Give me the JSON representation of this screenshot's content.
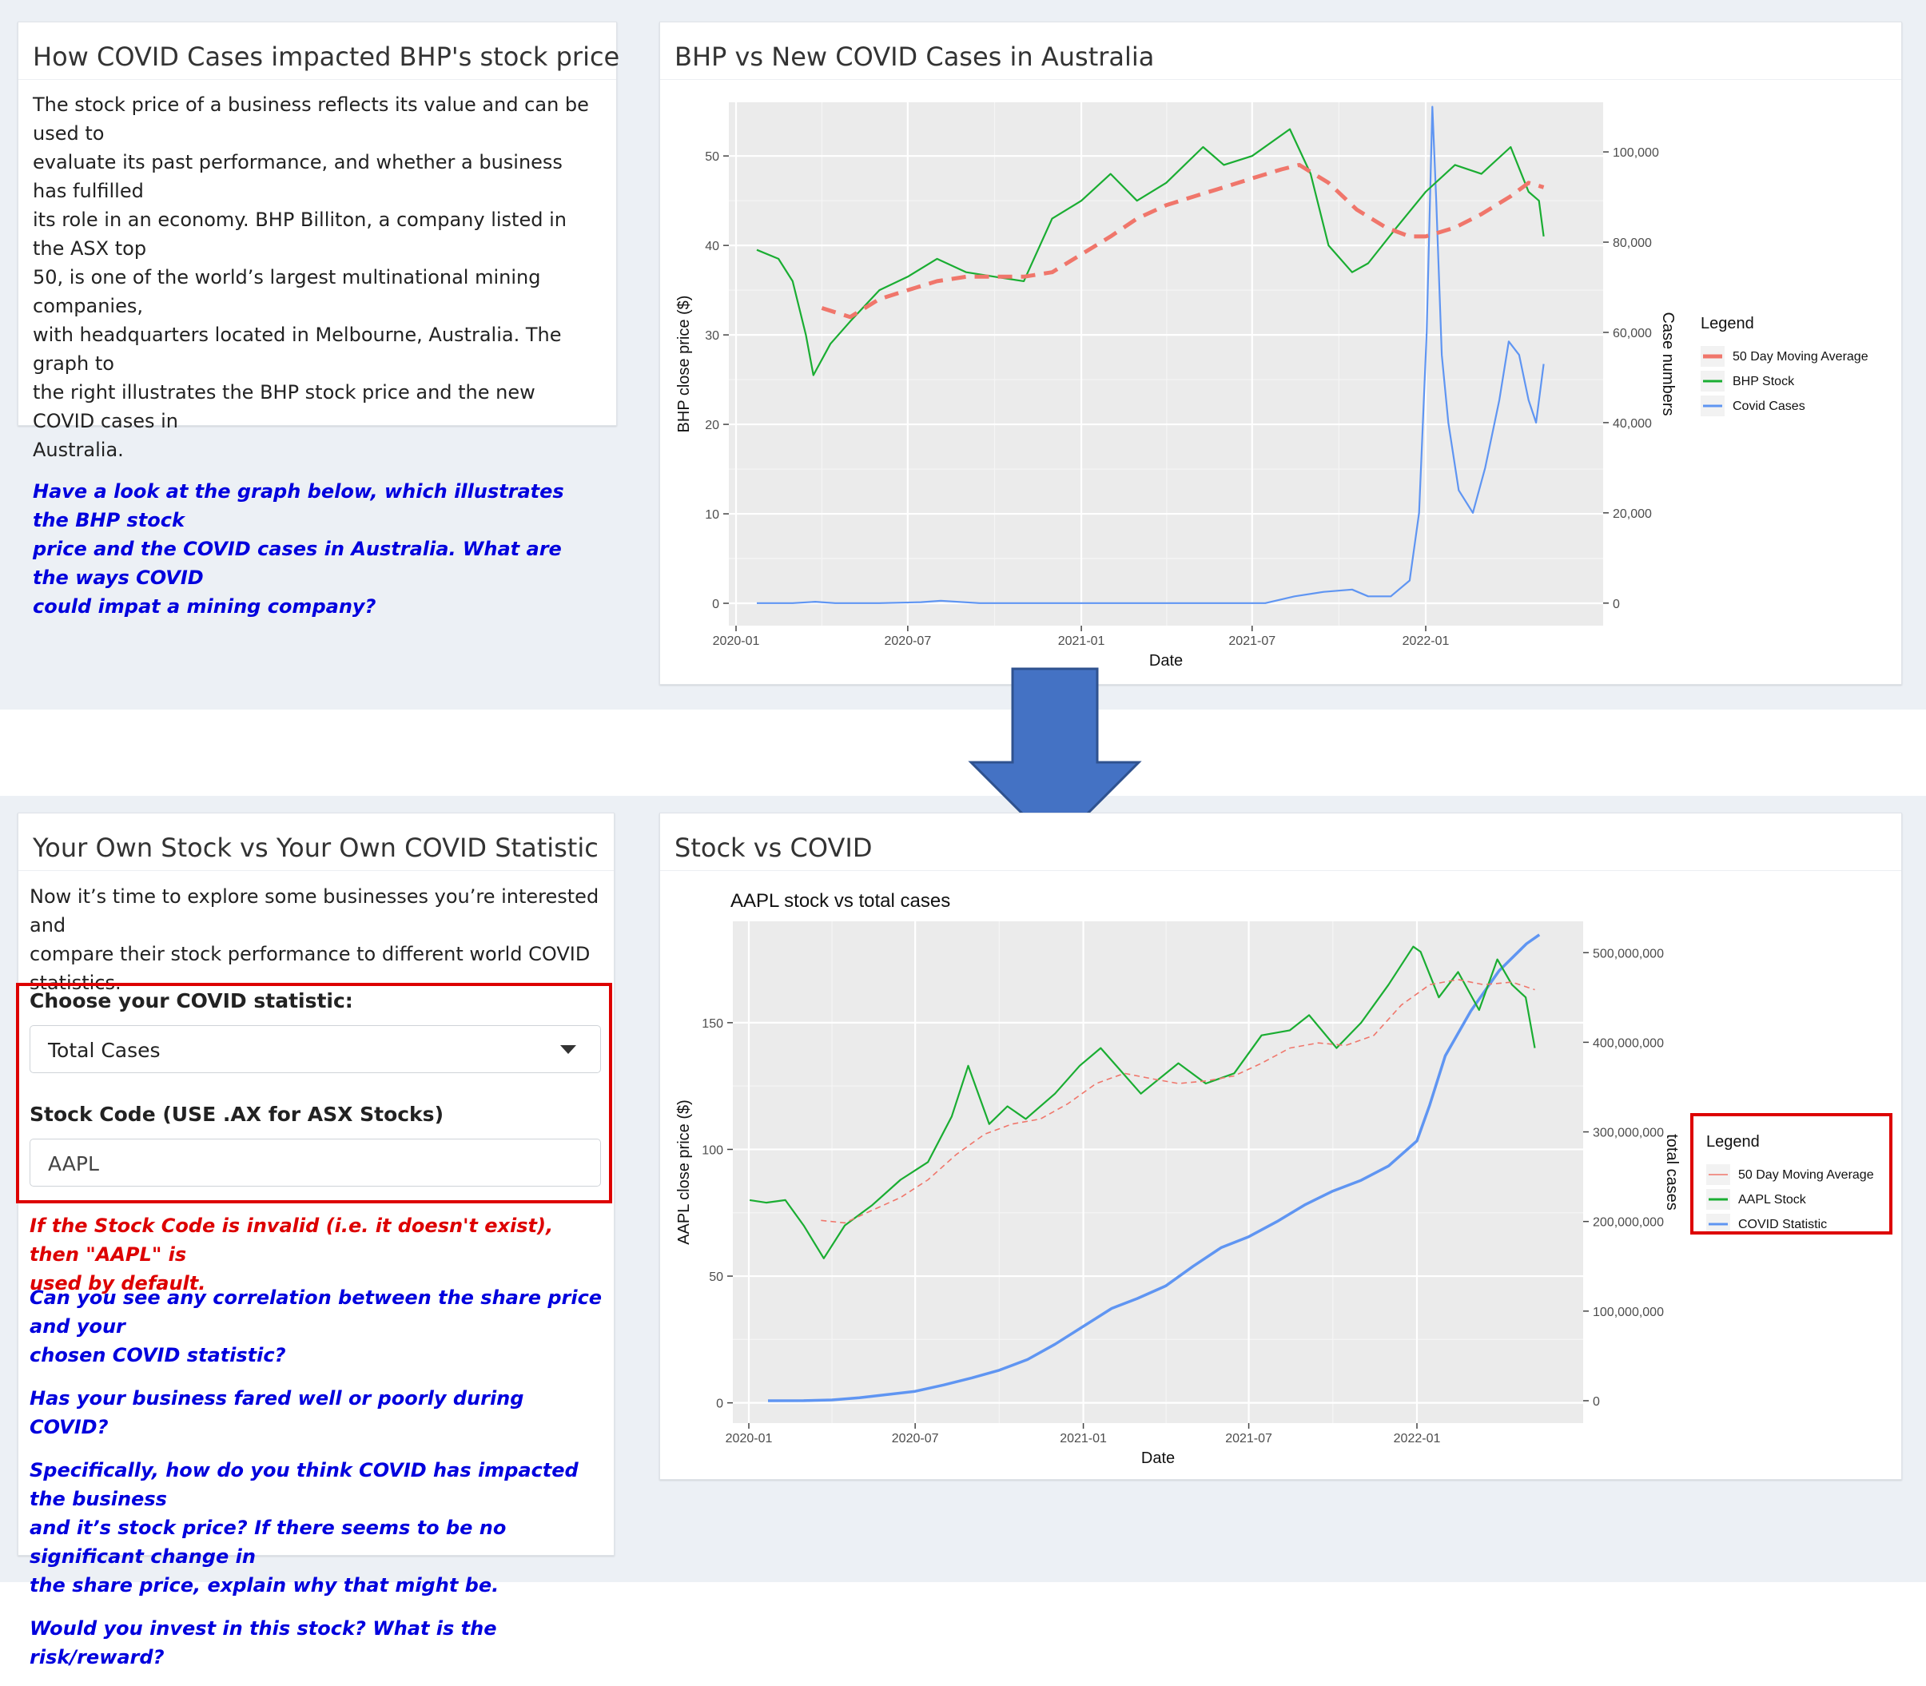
{
  "top_left": {
    "title": "How COVID Cases impacted BHP's stock price",
    "intro_lines": [
      "The stock price of a business reflects its value and can be used to",
      "evaluate its past performance, and whether a business has fulfilled",
      "its role in an economy. BHP Billiton, a company listed in the ASX top",
      "50, is one of the world’s largest multinational mining companies,",
      "with headquarters located in Melbourne, Australia. The graph to",
      "the right illustrates the BHP stock price and the new COVID cases in",
      "Australia."
    ],
    "question_lines": [
      "Have a look at the graph below, which illustrates the BHP stock",
      "price and the COVID cases in Australia. What are the ways COVID",
      "could impat a mining company?"
    ]
  },
  "top_right": {
    "title": "BHP vs New COVID Cases in Australia"
  },
  "bottom_left": {
    "title": "Your Own Stock vs Your Own COVID Statistic",
    "intro_lines": [
      "Now it’s time to explore some businesses you’re interested and",
      "compare their stock performance to different world COVID",
      "statistics."
    ],
    "covid_label": "Choose your COVID statistic:",
    "covid_selected": "Total Cases",
    "stock_label": "Stock Code (USE .AX for ASX Stocks)",
    "stock_value": "AAPL",
    "note_lines": [
      "If the Stock Code is invalid (i.e. it doesn't exist), then \"AAPL\" is",
      "used by default."
    ],
    "questions": [
      [
        "Can you see any correlation between the share price and your",
        "chosen COVID statistic?"
      ],
      [
        "Has your business fared well or poorly during COVID?"
      ],
      [
        "Specifically, how do you think COVID has impacted the business",
        "and it’s stock price? If there seems to be no significant change in",
        "the share price, explain why that might be."
      ],
      [
        "Would you invest in this stock? What is the risk/reward?"
      ]
    ]
  },
  "bottom_right": {
    "title": "Stock vs COVID"
  },
  "colors": {
    "ma": "#f0766b",
    "stock": "#1aad32",
    "covid": "#5f95f2",
    "arrow": "#4472c4",
    "highlight": "#dd0000"
  },
  "chart_data": [
    {
      "type": "line",
      "title": "",
      "xlabel": "Date",
      "ylabel": "BHP close price ($)",
      "y2label": "Case numbers",
      "x_ticks": [
        "2020-01",
        "2020-07",
        "2021-01",
        "2021-07",
        "2022-01"
      ],
      "y_ticks": [
        "0",
        "10",
        "20",
        "30",
        "40",
        "50"
      ],
      "y2_ticks": [
        "0",
        "20,000",
        "40,000",
        "60,000",
        "80,000",
        "100,000"
      ],
      "ylim": [
        -2.5,
        56
      ],
      "y2lim": [
        -5000,
        111000
      ],
      "grid": true,
      "legend_position": "right",
      "legend_title": "Legend",
      "legend": [
        "50 Day Moving Average",
        "BHP Stock",
        "Covid Cases"
      ],
      "series": [
        {
          "name": "BHP Stock",
          "axis": "left",
          "x": [
            "2020-01-23",
            "2020-02-15",
            "2020-03-01",
            "2020-03-15",
            "2020-03-23",
            "2020-04-10",
            "2020-05-01",
            "2020-06-01",
            "2020-07-01",
            "2020-08-01",
            "2020-09-01",
            "2020-10-01",
            "2020-11-01",
            "2020-12-01",
            "2021-01-01",
            "2021-02-01",
            "2021-03-01",
            "2021-04-01",
            "2021-05-10",
            "2021-06-01",
            "2021-07-01",
            "2021-08-10",
            "2021-09-01",
            "2021-09-20",
            "2021-10-15",
            "2021-11-01",
            "2021-12-01",
            "2022-01-01",
            "2022-02-01",
            "2022-03-01",
            "2022-04-01",
            "2022-04-20",
            "2022-05-01",
            "2022-05-06"
          ],
          "values": [
            39.5,
            38.5,
            36,
            30,
            25.5,
            29,
            31.5,
            35,
            36.5,
            38.5,
            37,
            36.5,
            36,
            43,
            45,
            48,
            45,
            47,
            51,
            49,
            50,
            53,
            48,
            40,
            37,
            38,
            42,
            46,
            49,
            48,
            51,
            46,
            45,
            41
          ]
        },
        {
          "name": "50 Day Moving Average",
          "axis": "left",
          "x": [
            "2020-04-01",
            "2020-05-01",
            "2020-06-01",
            "2020-07-01",
            "2020-08-01",
            "2020-09-01",
            "2020-10-01",
            "2020-11-01",
            "2020-12-01",
            "2021-01-01",
            "2021-02-01",
            "2021-03-01",
            "2021-04-01",
            "2021-05-01",
            "2021-06-01",
            "2021-07-01",
            "2021-08-01",
            "2021-08-20",
            "2021-09-20",
            "2021-10-20",
            "2021-11-20",
            "2021-12-15",
            "2022-01-01",
            "2022-02-01",
            "2022-03-01",
            "2022-04-01",
            "2022-04-20",
            "2022-05-06"
          ],
          "values": [
            33,
            32,
            34,
            35,
            36,
            36.5,
            36.5,
            36.5,
            37,
            39,
            41,
            43,
            44.5,
            45.5,
            46.5,
            47.5,
            48.5,
            49,
            47,
            44,
            42,
            41,
            41,
            42,
            43.5,
            45.5,
            47,
            46.5
          ]
        },
        {
          "name": "Covid Cases",
          "axis": "right",
          "x": [
            "2020-01-23",
            "2020-03-01",
            "2020-03-25",
            "2020-04-15",
            "2020-06-01",
            "2020-07-15",
            "2020-08-05",
            "2020-09-15",
            "2021-01-01",
            "2021-06-01",
            "2021-07-15",
            "2021-08-15",
            "2021-09-15",
            "2021-10-15",
            "2021-11-01",
            "2021-11-25",
            "2021-12-15",
            "2021-12-25",
            "2022-01-02",
            "2022-01-08",
            "2022-01-12",
            "2022-01-18",
            "2022-01-25",
            "2022-02-05",
            "2022-02-20",
            "2022-03-05",
            "2022-03-20",
            "2022-03-30",
            "2022-04-10",
            "2022-04-20",
            "2022-04-28",
            "2022-05-06"
          ],
          "values": [
            0,
            0,
            300,
            0,
            0,
            200,
            500,
            0,
            0,
            0,
            0,
            1500,
            2500,
            3000,
            1500,
            1500,
            5000,
            20000,
            60000,
            110000,
            90000,
            55000,
            40000,
            25000,
            20000,
            30000,
            45000,
            58000,
            55000,
            45000,
            40000,
            53000
          ]
        }
      ]
    },
    {
      "type": "line",
      "title": "AAPL stock vs total cases",
      "xlabel": "Date",
      "ylabel": "AAPL close price ($)",
      "y2label": "total cases",
      "x_ticks": [
        "2020-01",
        "2020-07",
        "2021-01",
        "2021-07",
        "2022-01"
      ],
      "y_ticks": [
        "0",
        "50",
        "100",
        "150"
      ],
      "y2_ticks": [
        "0",
        "100,000,000",
        "200,000,000",
        "300,000,000",
        "400,000,000",
        "500,000,000"
      ],
      "ylim": [
        -8,
        190
      ],
      "y2lim": [
        -25000000,
        535000000
      ],
      "grid": true,
      "legend_position": "right",
      "legend_title": "Legend",
      "legend": [
        "50 Day Moving Average",
        "AAPL  Stock",
        "COVID Statistic"
      ],
      "series": [
        {
          "name": "AAPL  Stock",
          "axis": "left",
          "x": [
            "2020-01-02",
            "2020-01-20",
            "2020-02-10",
            "2020-03-01",
            "2020-03-23",
            "2020-04-15",
            "2020-05-15",
            "2020-06-15",
            "2020-07-15",
            "2020-08-10",
            "2020-08-28",
            "2020-09-20",
            "2020-10-10",
            "2020-10-30",
            "2020-12-01",
            "2020-12-28",
            "2021-01-20",
            "2021-03-05",
            "2021-04-15",
            "2021-05-15",
            "2021-06-15",
            "2021-07-15",
            "2021-08-15",
            "2021-09-05",
            "2021-10-05",
            "2021-11-01",
            "2021-12-01",
            "2021-12-28",
            "2022-01-05",
            "2022-01-25",
            "2022-02-15",
            "2022-03-10",
            "2022-03-30",
            "2022-04-15",
            "2022-04-30",
            "2022-05-10"
          ],
          "values": [
            80,
            79,
            80,
            70,
            57,
            70,
            78,
            88,
            95,
            113,
            133,
            110,
            117,
            112,
            122,
            133,
            140,
            122,
            134,
            126,
            130,
            145,
            147,
            153,
            140,
            150,
            165,
            180,
            178,
            160,
            170,
            155,
            175,
            165,
            160,
            140
          ]
        },
        {
          "name": "50 Day Moving Average",
          "axis": "left",
          "x": [
            "2020-03-20",
            "2020-04-15",
            "2020-05-15",
            "2020-06-15",
            "2020-07-15",
            "2020-08-15",
            "2020-09-15",
            "2020-10-15",
            "2020-11-15",
            "2020-12-15",
            "2021-01-15",
            "2021-02-15",
            "2021-03-15",
            "2021-04-15",
            "2021-05-15",
            "2021-06-15",
            "2021-07-15",
            "2021-08-15",
            "2021-09-15",
            "2021-10-15",
            "2021-11-15",
            "2021-12-15",
            "2022-01-15",
            "2022-02-15",
            "2022-03-15",
            "2022-04-15",
            "2022-05-10"
          ],
          "values": [
            72,
            71,
            76,
            81,
            88,
            98,
            106,
            110,
            112,
            118,
            126,
            130,
            128,
            126,
            127,
            129,
            134,
            140,
            142,
            141,
            145,
            157,
            165,
            167,
            165,
            166,
            163
          ]
        },
        {
          "name": "COVID Statistic",
          "axis": "right",
          "x": [
            "2020-01-22",
            "2020-03-01",
            "2020-04-01",
            "2020-05-01",
            "2020-07-01",
            "2020-08-01",
            "2020-09-01",
            "2020-10-01",
            "2020-11-01",
            "2020-12-01",
            "2021-01-01",
            "2021-02-01",
            "2021-03-01",
            "2021-04-01",
            "2021-05-01",
            "2021-06-01",
            "2021-07-01",
            "2021-08-01",
            "2021-09-01",
            "2021-10-01",
            "2021-11-01",
            "2021-12-01",
            "2022-01-01",
            "2022-01-15",
            "2022-02-01",
            "2022-03-01",
            "2022-04-01",
            "2022-05-01",
            "2022-05-15"
          ],
          "values": [
            0,
            100000,
            900000,
            3300000,
            10500000,
            17500000,
            25500000,
            34000000,
            46000000,
            63000000,
            83000000,
            103000000,
            114000000,
            128000000,
            150000000,
            171000000,
            183000000,
            200000000,
            219000000,
            234000000,
            246000000,
            262000000,
            290000000,
            330000000,
            385000000,
            435000000,
            480000000,
            510000000,
            520000000
          ]
        }
      ]
    }
  ]
}
